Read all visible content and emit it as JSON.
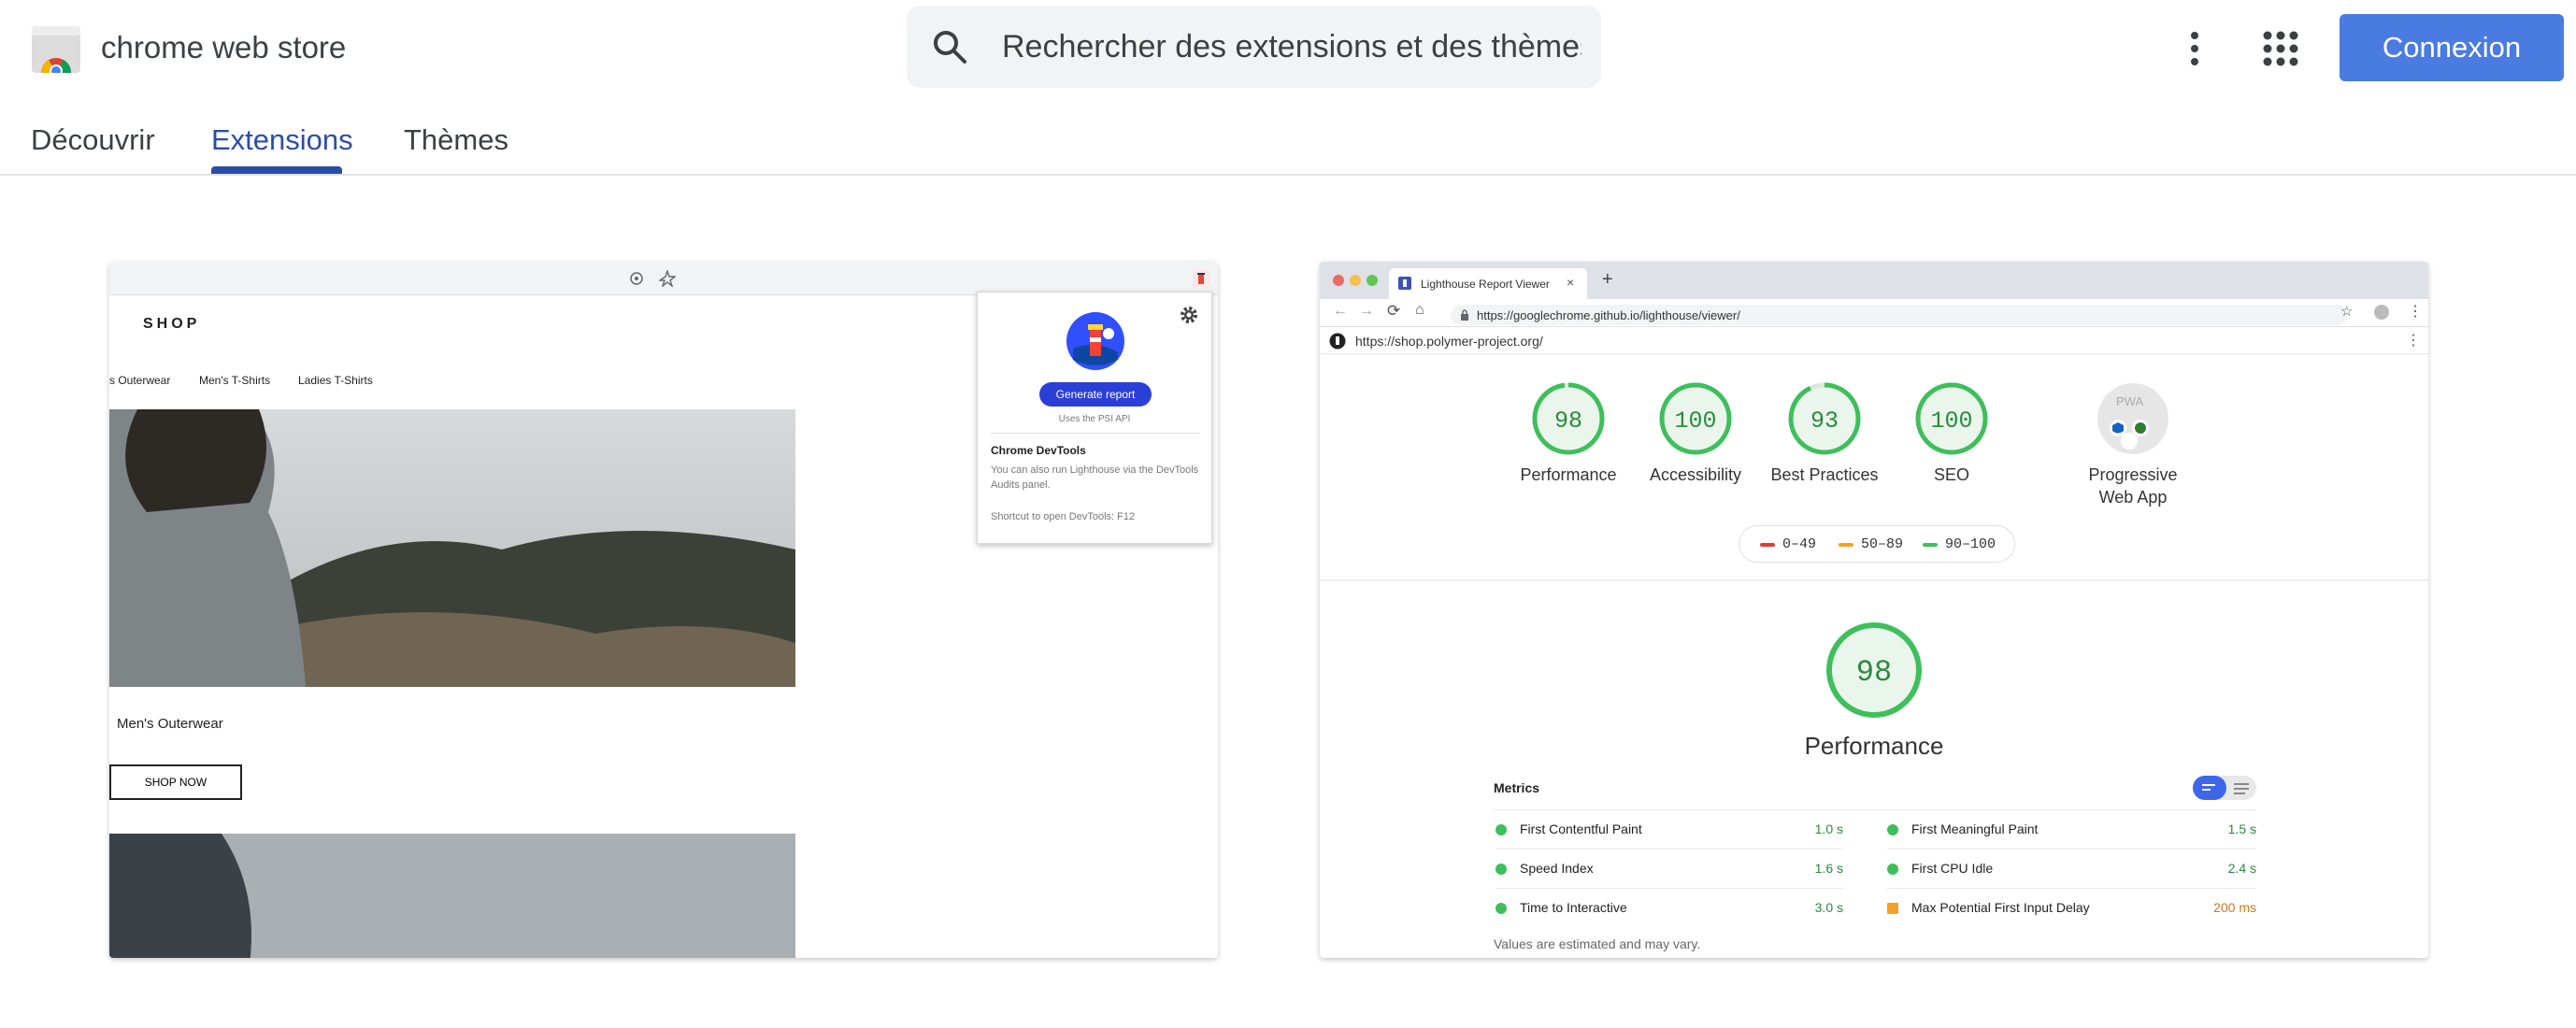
{
  "header": {
    "brand": "chrome web store",
    "search_placeholder": "Rechercher des extensions et des thèmes",
    "login_label": "Connexion"
  },
  "tabs": [
    {
      "label": "Découvrir"
    },
    {
      "label": "Extensions"
    },
    {
      "label": "Thèmes"
    }
  ],
  "shot_left": {
    "shop_title": "SHOP",
    "nav": [
      "s Outerwear",
      "Men's T-Shirts",
      "Ladies T-Shirts"
    ],
    "product_title": "Men's Outerwear",
    "shop_now": "SHOP NOW",
    "popup": {
      "generate": "Generate report",
      "uses": "Uses the PSI API",
      "heading": "Chrome DevTools",
      "text": "You can also run Lighthouse via the DevTools Audits panel.",
      "shortcut": "Shortcut to open DevTools: F12"
    }
  },
  "shot_right": {
    "tab_title": "Lighthouse Report Viewer",
    "url": "https://googlechrome.github.io/lighthouse/viewer/",
    "page_url": "https://shop.polymer-project.org/",
    "gauges": [
      {
        "score": "98",
        "label": "Performance"
      },
      {
        "score": "100",
        "label": "Accessibility"
      },
      {
        "score": "93",
        "label": "Best Practices"
      },
      {
        "score": "100",
        "label": "SEO"
      }
    ],
    "pwa_label_1": "Progressive",
    "pwa_label_2": "Web App",
    "pwa_badge": "PWA",
    "legend": [
      "0–49",
      "50–89",
      "90–100"
    ],
    "big_score": "98",
    "big_label": "Performance",
    "metrics_title": "Metrics",
    "metrics_left": [
      {
        "name": "First Contentful Paint",
        "value": "1.0 s"
      },
      {
        "name": "Speed Index",
        "value": "1.6 s"
      },
      {
        "name": "Time to Interactive",
        "value": "3.0 s"
      }
    ],
    "metrics_right": [
      {
        "name": "First Meaningful Paint",
        "value": "1.5 s"
      },
      {
        "name": "First CPU Idle",
        "value": "2.4 s"
      },
      {
        "name": "Max Potential First Input Delay",
        "value": "200 ms"
      }
    ],
    "footnote": "Values are estimated and may vary."
  },
  "colors": {
    "accent": "#2c4da6",
    "login_bg": "#4a7be0",
    "pass": "#3fbf5c",
    "average": "#f2a12b",
    "fail": "#e23b3b"
  }
}
